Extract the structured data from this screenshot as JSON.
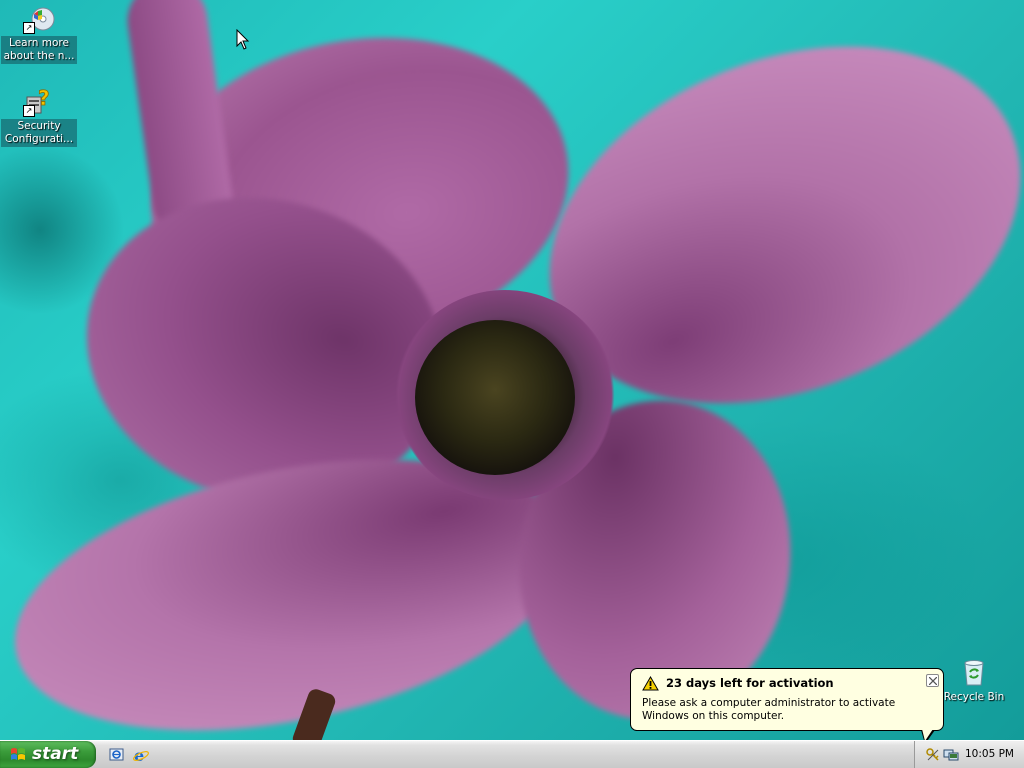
{
  "desktop": {
    "icons": [
      {
        "label": "Learn more about the n...",
        "icon": "windows-cd-icon"
      },
      {
        "label": "Security Configurati...",
        "icon": "help-question-icon"
      },
      {
        "label": "Recycle Bin",
        "icon": "recycle-bin-icon"
      }
    ]
  },
  "balloon": {
    "title": "23 days left for activation",
    "message": "Please ask a computer administrator to activate Windows on this computer.",
    "icon": "warning-icon"
  },
  "taskbar": {
    "start_label": "start",
    "quick_launch": [
      "windows-explorer-icon",
      "internet-explorer-icon"
    ],
    "tray_icons": [
      "activation-keys-icon",
      "network-icon"
    ],
    "clock": "10:05 PM"
  },
  "colors": {
    "start_green": "#3a9b3a",
    "balloon_bg": "#ffffe1",
    "wallpaper_teal": "#22b8b4",
    "petal_pink": "#b474aa"
  }
}
